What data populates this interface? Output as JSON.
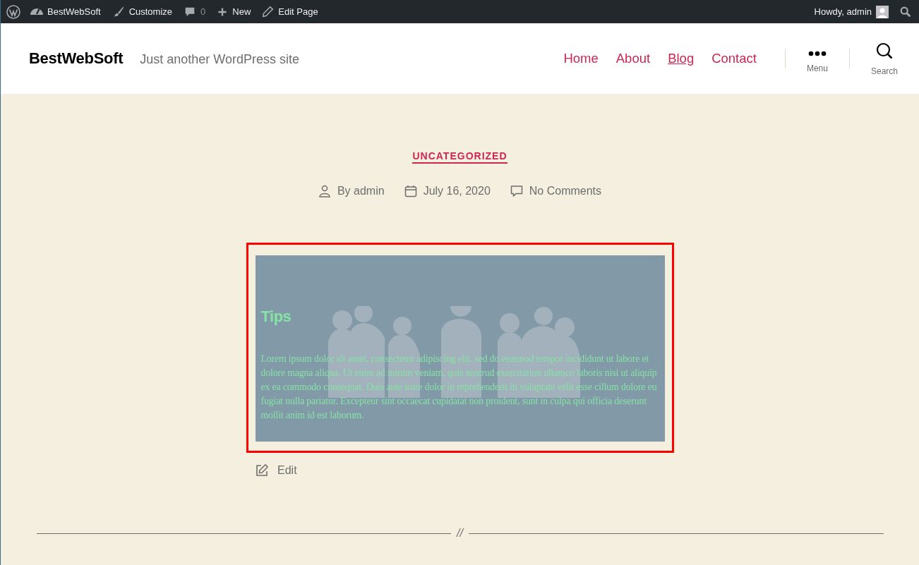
{
  "admin_bar": {
    "items": [
      {
        "kind": "site",
        "label": "BestWebSoft"
      },
      {
        "kind": "customize",
        "label": "Customize"
      },
      {
        "kind": "comments",
        "label": "0"
      },
      {
        "kind": "new",
        "label": "New"
      },
      {
        "kind": "edit",
        "label": "Edit Page"
      }
    ],
    "greeting": "Howdy, admin"
  },
  "header": {
    "site_title": "BestWebSoft",
    "tagline": "Just another WordPress site",
    "nav": [
      {
        "label": "Home",
        "selected": false
      },
      {
        "label": "About",
        "selected": false
      },
      {
        "label": "Blog",
        "selected": true
      },
      {
        "label": "Contact",
        "selected": false
      }
    ],
    "menu_label": "Menu",
    "search_label": "Search"
  },
  "post": {
    "category": "UNCATEGORIZED",
    "author": "By admin",
    "date": "July 16, 2020",
    "comments": "No Comments",
    "cover": {
      "title": "Tips",
      "text": "Lorem ipsum dolor sit amet, consectetur adipiscing elit, sed do eiusmod tempor incididunt ut labore et dolore magna aliqua. Ut enim ad minim veniam, quis nostrud exercitation ullamco laboris nisi ut aliquip ex ea commodo consequat. Duis aute irure dolor in reprehenderit in voluptate velit esse cillum dolore eu fugiat nulla pariatur. Excepteur sint occaecat cupidatat non proident, sunt in culpa qui officia deserunt mollit anim id est laborum."
    },
    "edit_label": "Edit"
  },
  "separator": "//"
}
